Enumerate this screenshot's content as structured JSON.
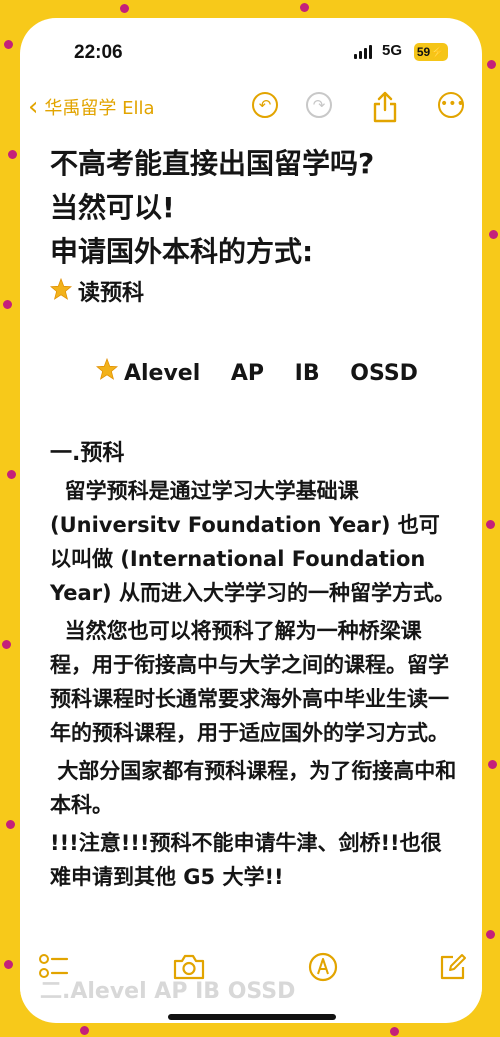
{
  "status": {
    "time": "22:06",
    "network": "5G",
    "battery": "59"
  },
  "nav": {
    "back_label": "华禹留学 Ella"
  },
  "note": {
    "title_lines": [
      "不高考能直接出国留学吗?",
      "当然可以!",
      "申请国外本科的方式:"
    ],
    "bullets": [
      "读预科",
      "Alevel    AP    IB    OSSD"
    ],
    "section": "一.预科",
    "paragraphs": [
      "  留学预科是通过学习大学基础课 (Universitv Foundation Year) 也可以叫做 (International Foundation Year) 从而进入大学学习的一种留学方式。",
      "  当然您也可以将预科了解为一种桥梁课程，用于衔接高中与大学之间的课程。留学预科课程时长通常要求海外高中毕业生读一年的预科课程，用于适应国外的学习方式。",
      " 大部分国家都有预科课程，为了衔接高中和本科。",
      "!!!注意!!!预科不能申请牛津、剑桥!!也很难申请到其他 G5 大学!!"
    ],
    "next_section_peek": "二.Alevel    AP    IB    OSSD"
  },
  "icons": {
    "back": "chevron-left-icon",
    "undo": "undo-icon",
    "redo": "redo-icon",
    "share": "share-icon",
    "more": "more-icon",
    "checklist": "checklist-icon",
    "camera": "camera-icon",
    "markup": "markup-pen-icon",
    "compose": "compose-icon",
    "bullet": "star-icon"
  },
  "colors": {
    "accent": "#e2a400",
    "frame": "#f7c91a",
    "dots": "#c4207a"
  }
}
